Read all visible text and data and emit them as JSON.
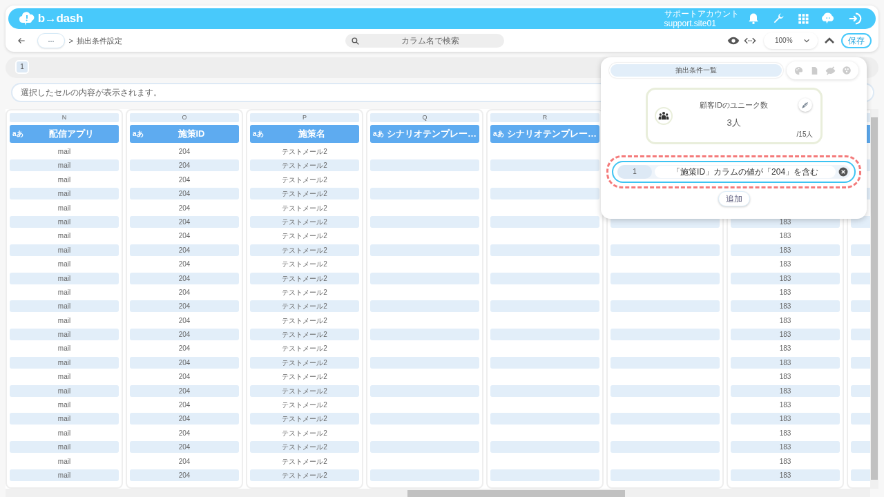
{
  "header": {
    "logo": "b→dash",
    "account_name": "サポートアカウント",
    "account_id": "support.site01"
  },
  "toolbar": {
    "breadcrumb_separator": ">",
    "breadcrumb": "抽出条件設定",
    "search": {
      "placeholder": "カラム名で検索"
    },
    "zoom": "100%",
    "save": "保存"
  },
  "pages": [
    {
      "label": "1",
      "selected": true
    }
  ],
  "cell_preview": {
    "placeholder": "選択したセルの内容が表示されます。"
  },
  "table": {
    "columns": [
      {
        "letter": "N",
        "type_label": "aあ",
        "name": "配信アプリ"
      },
      {
        "letter": "O",
        "type_label": "aあ",
        "name": "施策ID"
      },
      {
        "letter": "P",
        "type_label": "aあ",
        "name": "施策名"
      },
      {
        "letter": "Q",
        "type_label": "aあ",
        "name": "シナリオテンプレー…"
      },
      {
        "letter": "R",
        "type_label": "aあ",
        "name": "シナリオテンプレー…"
      }
    ],
    "rows": [
      [
        "mail",
        "204",
        "テストメール2",
        null,
        null,
        null,
        null,
        null
      ],
      [
        "mail",
        "204",
        "テストメール2",
        null,
        null,
        null,
        null,
        null
      ],
      [
        "mail",
        "204",
        "テストメール2",
        null,
        null,
        null,
        null,
        null
      ],
      [
        "mail",
        "204",
        "テストメール2",
        null,
        null,
        null,
        null,
        null
      ],
      [
        "mail",
        "204",
        "テストメール2",
        null,
        null,
        null,
        null,
        null
      ],
      [
        "mail",
        "204",
        "テストメール2",
        null,
        null,
        null,
        "183",
        null
      ],
      [
        "mail",
        "204",
        "テストメール2",
        null,
        null,
        null,
        "183",
        null
      ],
      [
        "mail",
        "204",
        "テストメール2",
        null,
        null,
        null,
        "183",
        null
      ],
      [
        "mail",
        "204",
        "テストメール2",
        null,
        null,
        null,
        "183",
        null
      ],
      [
        "mail",
        "204",
        "テストメール2",
        null,
        null,
        null,
        "183",
        null
      ],
      [
        "mail",
        "204",
        "テストメール2",
        null,
        null,
        null,
        "183",
        null
      ],
      [
        "mail",
        "204",
        "テストメール2",
        null,
        null,
        null,
        "183",
        null
      ],
      [
        "mail",
        "204",
        "テストメール2",
        null,
        null,
        null,
        "183",
        null
      ],
      [
        "mail",
        "204",
        "テストメール2",
        null,
        null,
        null,
        "183",
        null
      ],
      [
        "mail",
        "204",
        "テストメール2",
        null,
        null,
        null,
        "183",
        null
      ],
      [
        "mail",
        "204",
        "テストメール2",
        null,
        null,
        null,
        "183",
        null
      ],
      [
        "mail",
        "204",
        "テストメール2",
        null,
        null,
        null,
        "183",
        null
      ],
      [
        "mail",
        "204",
        "テストメール2",
        null,
        null,
        null,
        "183",
        null
      ],
      [
        "mail",
        "204",
        "テストメール2",
        null,
        null,
        null,
        "183",
        null
      ],
      [
        "mail",
        "204",
        "テストメール2",
        null,
        null,
        null,
        "183",
        null
      ],
      [
        "mail",
        "204",
        "テストメール2",
        null,
        null,
        null,
        "183",
        null
      ],
      [
        "mail",
        "204",
        "テストメール2",
        null,
        null,
        null,
        "183",
        null
      ],
      [
        "mail",
        "204",
        "テストメール2",
        null,
        null,
        null,
        "183",
        null
      ],
      [
        "mail",
        "204",
        "テストメール2",
        null,
        null,
        null,
        "183",
        null
      ]
    ]
  },
  "popup": {
    "tab": "抽出条件一覧",
    "metric": {
      "title": "顧客IDのユニーク数",
      "value": "3人",
      "total": "/15人"
    },
    "conditions": [
      {
        "index": "1",
        "text": "「施策ID」カラムの値が「204」を含む",
        "highlighted": true
      }
    ],
    "add": "追加"
  }
}
